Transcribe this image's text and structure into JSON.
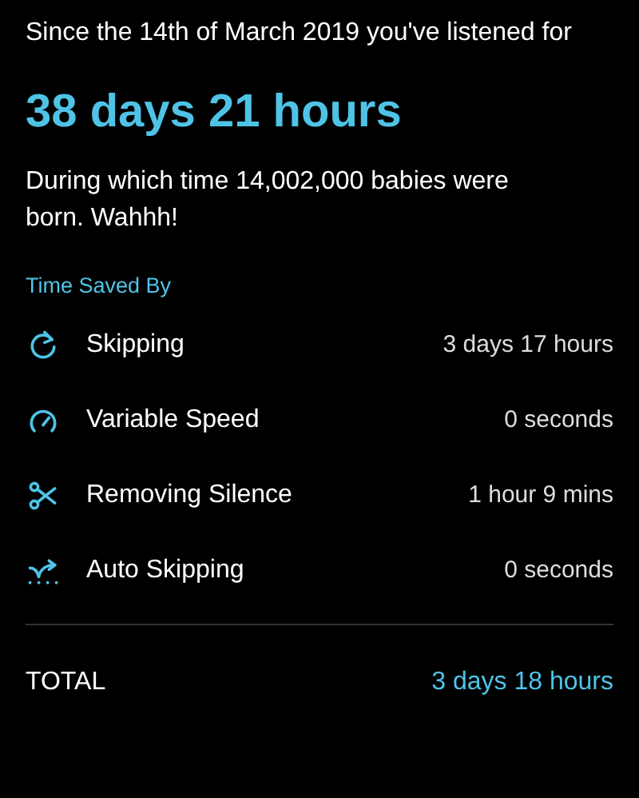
{
  "intro": "Since the 14th of March 2019 you've listened for",
  "headline": "38 days 21 hours",
  "fact": "During which time 14,002,000 babies were born. Wahhh!",
  "section_title": "Time Saved By",
  "rows": [
    {
      "kind": "skip",
      "label": "Skipping",
      "value": "3 days 17 hours"
    },
    {
      "kind": "speed",
      "label": "Variable Speed",
      "value": "0 seconds"
    },
    {
      "kind": "silence",
      "label": "Removing Silence",
      "value": "1 hour 9 mins"
    },
    {
      "kind": "auto",
      "label": "Auto Skipping",
      "value": "0 seconds"
    }
  ],
  "total": {
    "label": "TOTAL",
    "value": "3 days 18 hours"
  }
}
